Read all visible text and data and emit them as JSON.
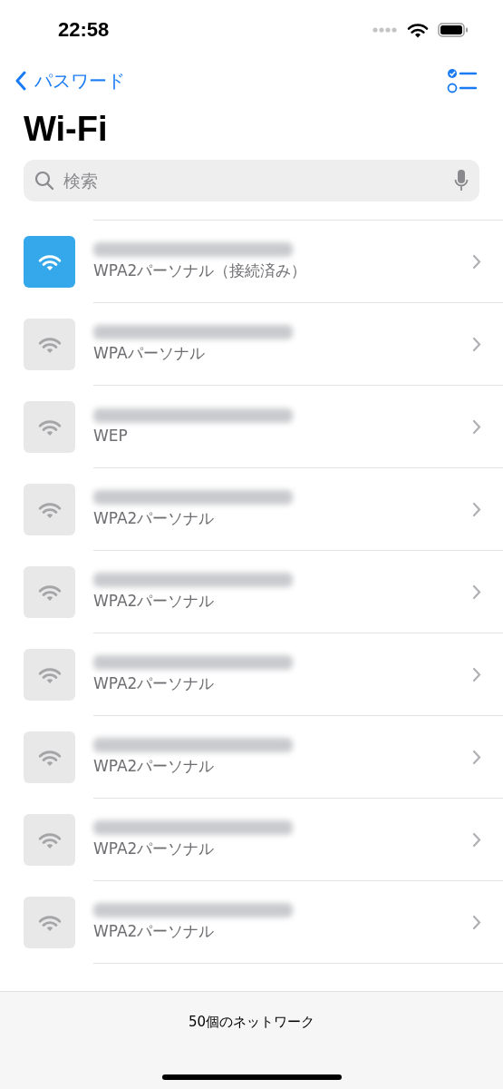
{
  "status_bar": {
    "time": "22:58"
  },
  "nav": {
    "back_label": "パスワード"
  },
  "title": "Wi-Fi",
  "search": {
    "placeholder": "検索"
  },
  "networks": [
    {
      "security": "WPA2パーソナル（接続済み）",
      "connected": true
    },
    {
      "security": "WPAパーソナル",
      "connected": false
    },
    {
      "security": "WEP",
      "connected": false
    },
    {
      "security": "WPA2パーソナル",
      "connected": false
    },
    {
      "security": "WPA2パーソナル",
      "connected": false
    },
    {
      "security": "WPA2パーソナル",
      "connected": false
    },
    {
      "security": "WPA2パーソナル",
      "connected": false
    },
    {
      "security": "WPA2パーソナル",
      "connected": false
    },
    {
      "security": "WPA2パーソナル",
      "connected": false
    }
  ],
  "footer": {
    "count_label": "50個のネットワーク"
  }
}
